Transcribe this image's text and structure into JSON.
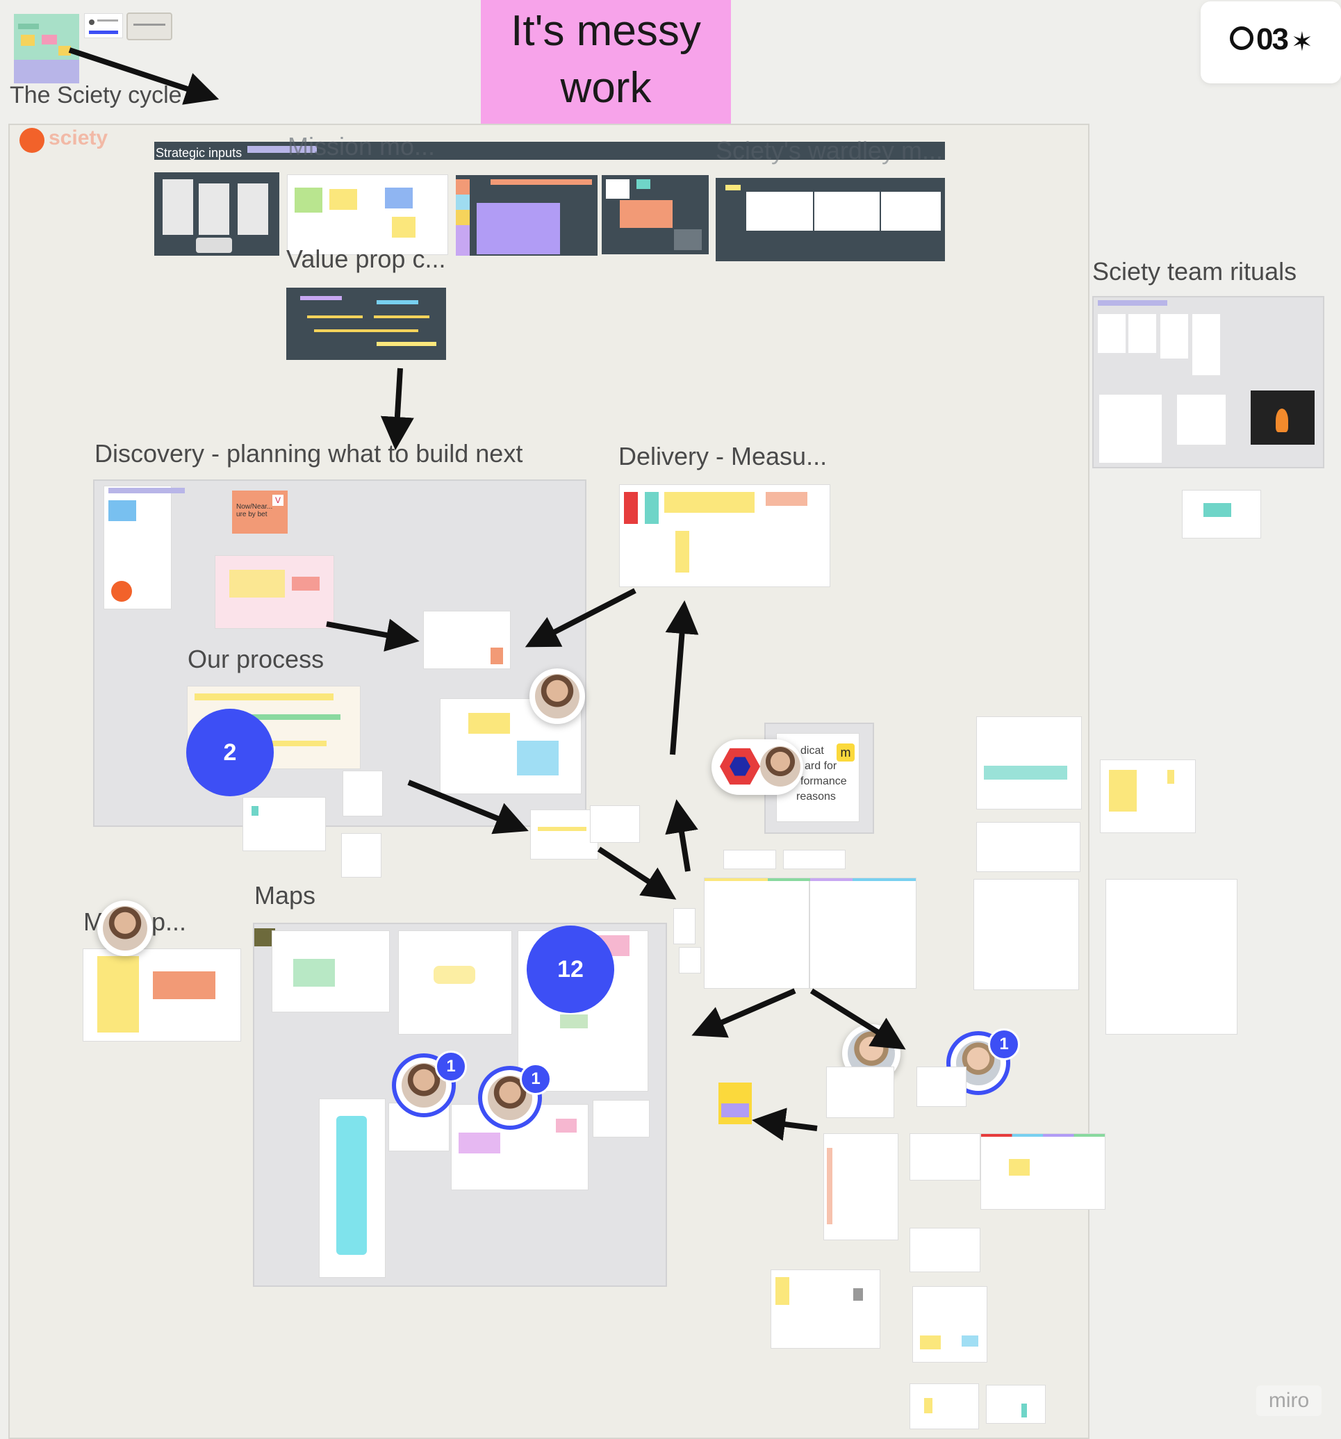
{
  "header": {
    "messy_note": "It's messy work",
    "brand_logo": "sciety",
    "reactions_label": "03",
    "watermark": "miro"
  },
  "frames": {
    "cycle": "The Sciety cycle",
    "strategic_inputs": "Strategic inputs",
    "mission": "Mission mo...",
    "wardley": "Sciety's wardley m...",
    "value_prop": "Value prop c...",
    "discovery": "Discovery - planning what to build next",
    "delivery": "Delivery - Measu...",
    "rituals": "Sciety team rituals",
    "process": "Our process",
    "maps": "Maps",
    "meeting": "M  ing p..."
  },
  "notes": {
    "now_near": "Now/Near... ure by bet",
    "indicator_line1": "dicat",
    "indicator_line2": "ard for",
    "indicator_line3": "formance",
    "indicator_line4": "reasons"
  },
  "comments": {
    "bubble_two": "2",
    "bubble_twelve": "12",
    "badge_a": "1",
    "badge_b": "1",
    "badge_c": "1"
  },
  "colors": {
    "canvas": "#efefec",
    "frame": "#e3e3e5",
    "dark_frame": "#3f4c55",
    "pink_note": "#f7a3ea",
    "comment_blue": "#3d4ff5",
    "sticky_yellow": "#fbe77c",
    "sticky_orange": "#f29a76"
  }
}
